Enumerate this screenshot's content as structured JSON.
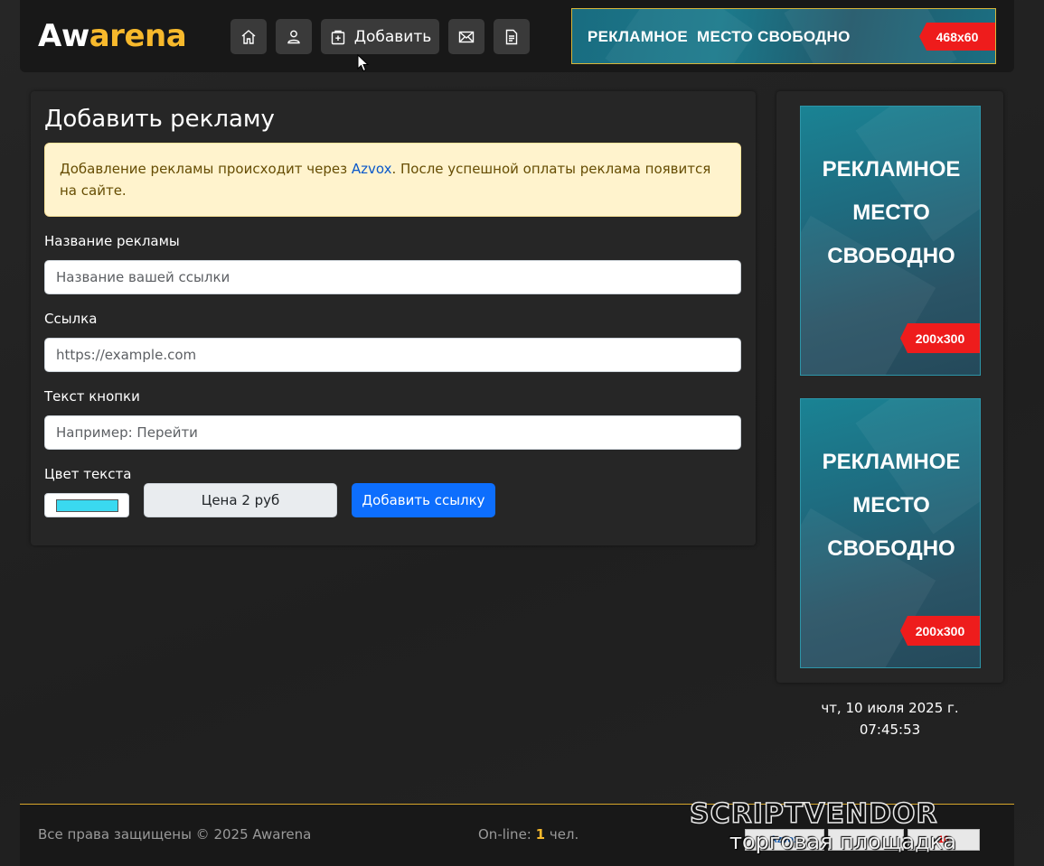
{
  "header": {
    "logo_part1": "Aw",
    "logo_part2": "arena",
    "nav": {
      "add_label": "Добавить"
    },
    "banner": {
      "text": "РЕКЛАМНОЕ  МЕСТО СВОБОДНО",
      "size": "468x60"
    }
  },
  "main": {
    "title": "Добавить рекламу",
    "alert": {
      "before": "Добавление рекламы происходит через ",
      "link": "Azvox",
      "after": ". После успешной оплаты реклама появится на сайте."
    },
    "fields": {
      "name_label": "Название рекламы",
      "name_placeholder": "Название вашей ссылки",
      "url_label": "Ссылка",
      "url_placeholder": "https://example.com",
      "button_label": "Текст кнопки",
      "button_placeholder": "Например: Перейти",
      "color_label": "Цвет текста",
      "color_value": "#3ad9f0"
    },
    "price": "Цена 2 руб",
    "submit": "Добавить ссылку"
  },
  "sidebar": {
    "banners": [
      {
        "line1": "РЕКЛАМНОЕ",
        "line2": "МЕСТО",
        "line3": "СВОБОДНО",
        "size": "200x300"
      },
      {
        "line1": "РЕКЛАМНОЕ",
        "line2": "МЕСТО",
        "line3": "СВОБОДНО",
        "size": "200x300"
      }
    ],
    "date": "чт, 10 июля 2025 г.",
    "time": "07:45:53"
  },
  "footer": {
    "copyright": "Все права защищены © 2025 Awarena",
    "online_prefix": "On-line: ",
    "online_count": "1",
    "online_suffix": " чел.",
    "counter1": "Azvox",
    "counter2": "",
    "counter3": "10"
  },
  "watermark": {
    "line1": "SCRIPTVENDOR",
    "line2": "торговая площадка"
  },
  "colors": {
    "accent": "#f7b92c",
    "primary": "#0d6efd",
    "alert_bg": "#fff3cd",
    "ribbon": "#ee1c1c"
  }
}
